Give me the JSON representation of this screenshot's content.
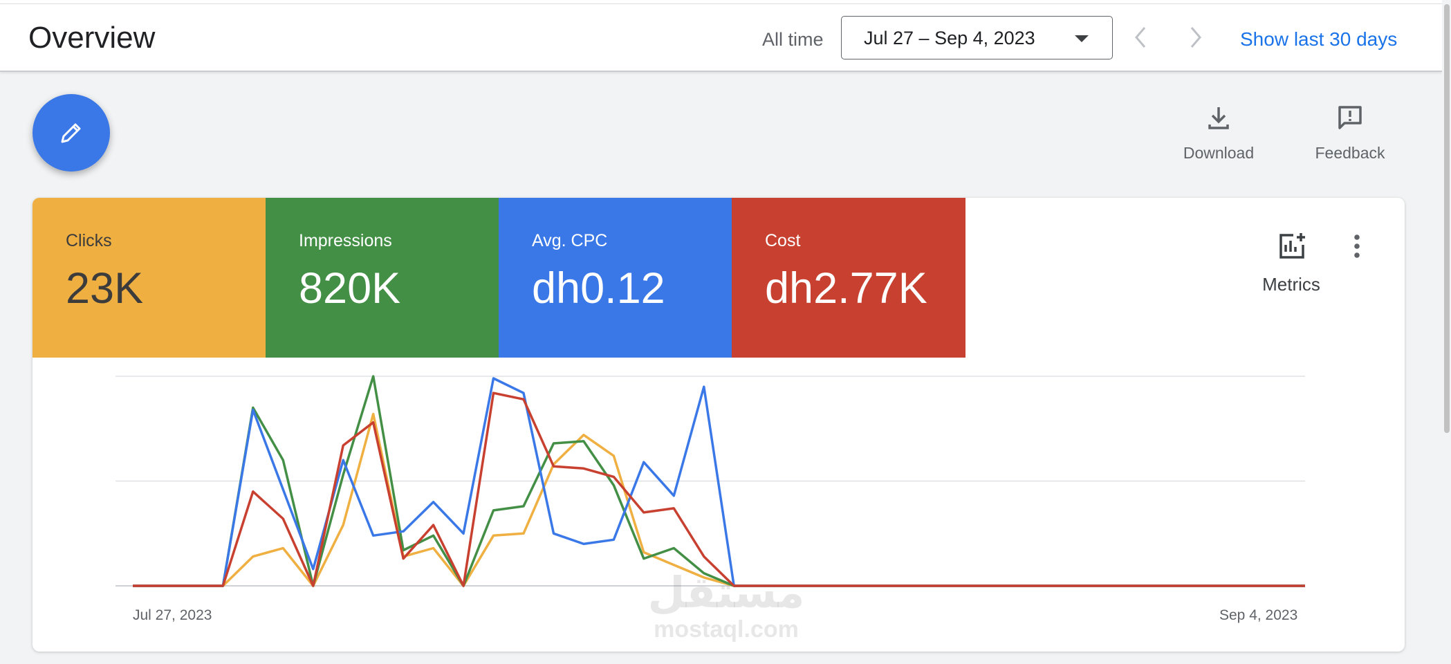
{
  "header": {
    "title": "Overview",
    "range_label": "All time",
    "date_range": "Jul 27 – Sep 4, 2023",
    "show_last": "Show last 30 days"
  },
  "actions": {
    "download": "Download",
    "feedback": "Feedback",
    "metrics": "Metrics"
  },
  "tiles": [
    {
      "name": "Clicks",
      "value": "23K",
      "color": "#efaf41"
    },
    {
      "name": "Impressions",
      "value": "820K",
      "color": "#438f46"
    },
    {
      "name": "Avg. CPC",
      "value": "dh0.12",
      "color": "#3b78e7"
    },
    {
      "name": "Cost",
      "value": "dh2.77K",
      "color": "#c8402f"
    }
  ],
  "watermark": {
    "arabic": "مستقل",
    "latin": "mostaql.com"
  },
  "chart_data": {
    "type": "line",
    "x_start_label": "Jul 27, 2023",
    "x_end_label": "Sep 4, 2023",
    "x": [
      "Jul 27",
      "Jul 28",
      "Jul 29",
      "Jul 30",
      "Jul 31",
      "Aug 1",
      "Aug 2",
      "Aug 3",
      "Aug 4",
      "Aug 5",
      "Aug 6",
      "Aug 7",
      "Aug 8",
      "Aug 9",
      "Aug 10",
      "Aug 11",
      "Aug 12",
      "Aug 13",
      "Aug 14",
      "Aug 15",
      "Aug 16",
      "Aug 17",
      "Aug 18",
      "Aug 19",
      "Aug 20",
      "Aug 21",
      "Aug 22",
      "Aug 23",
      "Aug 24",
      "Aug 25",
      "Aug 26",
      "Aug 27",
      "Aug 28",
      "Aug 29",
      "Aug 30",
      "Aug 31",
      "Sep 1",
      "Sep 2",
      "Sep 3",
      "Sep 4"
    ],
    "ylim": [
      0,
      1
    ],
    "grid": true,
    "series": [
      {
        "color": "#efaf41",
        "values": [
          0,
          0,
          0,
          0,
          0.14,
          0.18,
          0,
          0.29,
          0.82,
          0.14,
          0.18,
          0,
          0.24,
          0.25,
          0.58,
          0.72,
          0.62,
          0.16,
          0.1,
          0.04,
          0,
          0,
          0,
          0,
          0,
          0,
          0,
          0,
          0,
          0,
          0,
          0,
          0,
          0,
          0,
          0,
          0,
          0,
          0,
          0
        ]
      },
      {
        "color": "#438f46",
        "values": [
          0,
          0,
          0,
          0,
          0.85,
          0.6,
          0,
          0.53,
          1.0,
          0.17,
          0.24,
          0,
          0.36,
          0.38,
          0.68,
          0.69,
          0.48,
          0.13,
          0.18,
          0.06,
          0,
          0,
          0,
          0,
          0,
          0,
          0,
          0,
          0,
          0,
          0,
          0,
          0,
          0,
          0,
          0,
          0,
          0,
          0,
          0
        ]
      },
      {
        "color": "#3b78e7",
        "values": [
          0,
          0,
          0,
          0,
          0.84,
          0.46,
          0.08,
          0.6,
          0.24,
          0.26,
          0.4,
          0.25,
          0.99,
          0.92,
          0.25,
          0.2,
          0.22,
          0.59,
          0.43,
          0.95,
          0,
          0,
          0,
          0,
          0,
          0,
          0,
          0,
          0,
          0,
          0,
          0,
          0,
          0,
          0,
          0,
          0,
          0,
          0,
          0
        ]
      },
      {
        "color": "#c8402f",
        "values": [
          0,
          0,
          0,
          0,
          0.45,
          0.32,
          0,
          0.67,
          0.78,
          0.13,
          0.29,
          0,
          0.92,
          0.89,
          0.57,
          0.56,
          0.52,
          0.35,
          0.37,
          0.14,
          0,
          0,
          0,
          0,
          0,
          0,
          0,
          0,
          0,
          0,
          0,
          0,
          0,
          0,
          0,
          0,
          0,
          0,
          0,
          0
        ]
      }
    ]
  }
}
